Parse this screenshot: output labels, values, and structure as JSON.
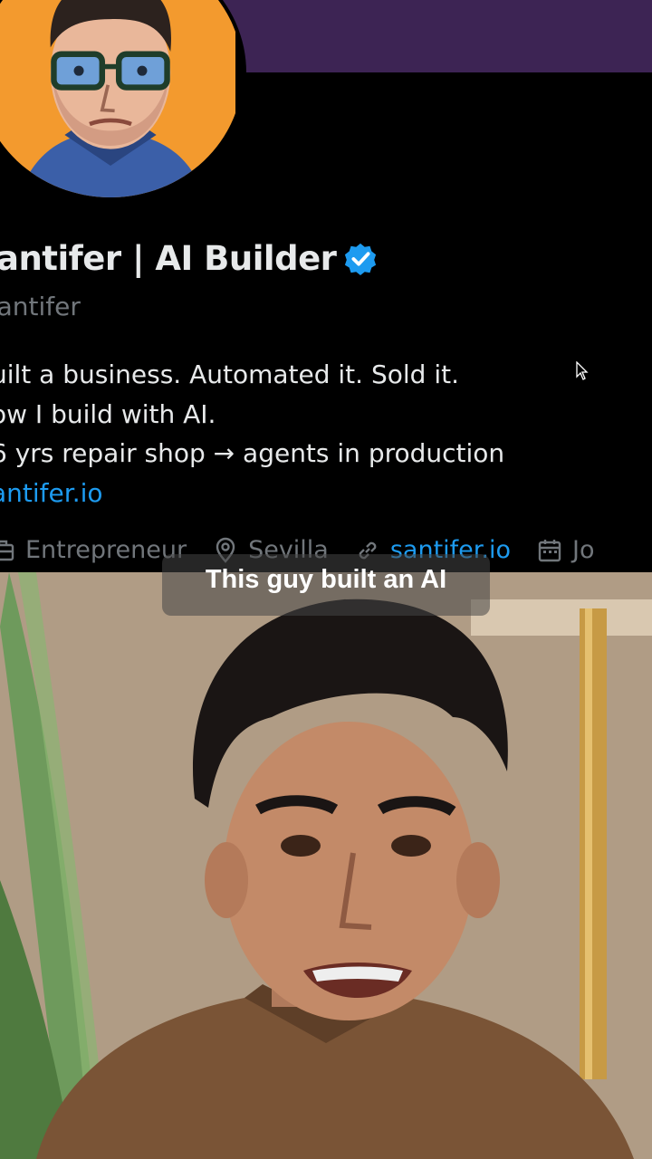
{
  "profile": {
    "display_name": "antifer | AI Builder",
    "handle": "santifer",
    "bio_lines": [
      "uilt a business. Automated it. Sold it.",
      "ow I build with AI.",
      "6 yrs repair shop → agents in production"
    ],
    "bio_link": "antifer.io",
    "meta": {
      "category": "Entrepreneur",
      "location": "Sevilla",
      "website": "santifer.io",
      "joined": "Jo"
    },
    "colors": {
      "accent": "#1d9bf0",
      "banner": "#3d2454",
      "avatar_bg": "#f39a2e"
    }
  },
  "video": {
    "caption": "This guy built an AI"
  },
  "icons": [
    "verified-badge-icon",
    "briefcase-icon",
    "location-pin-icon",
    "link-icon",
    "calendar-icon",
    "mouse-cursor-icon"
  ]
}
